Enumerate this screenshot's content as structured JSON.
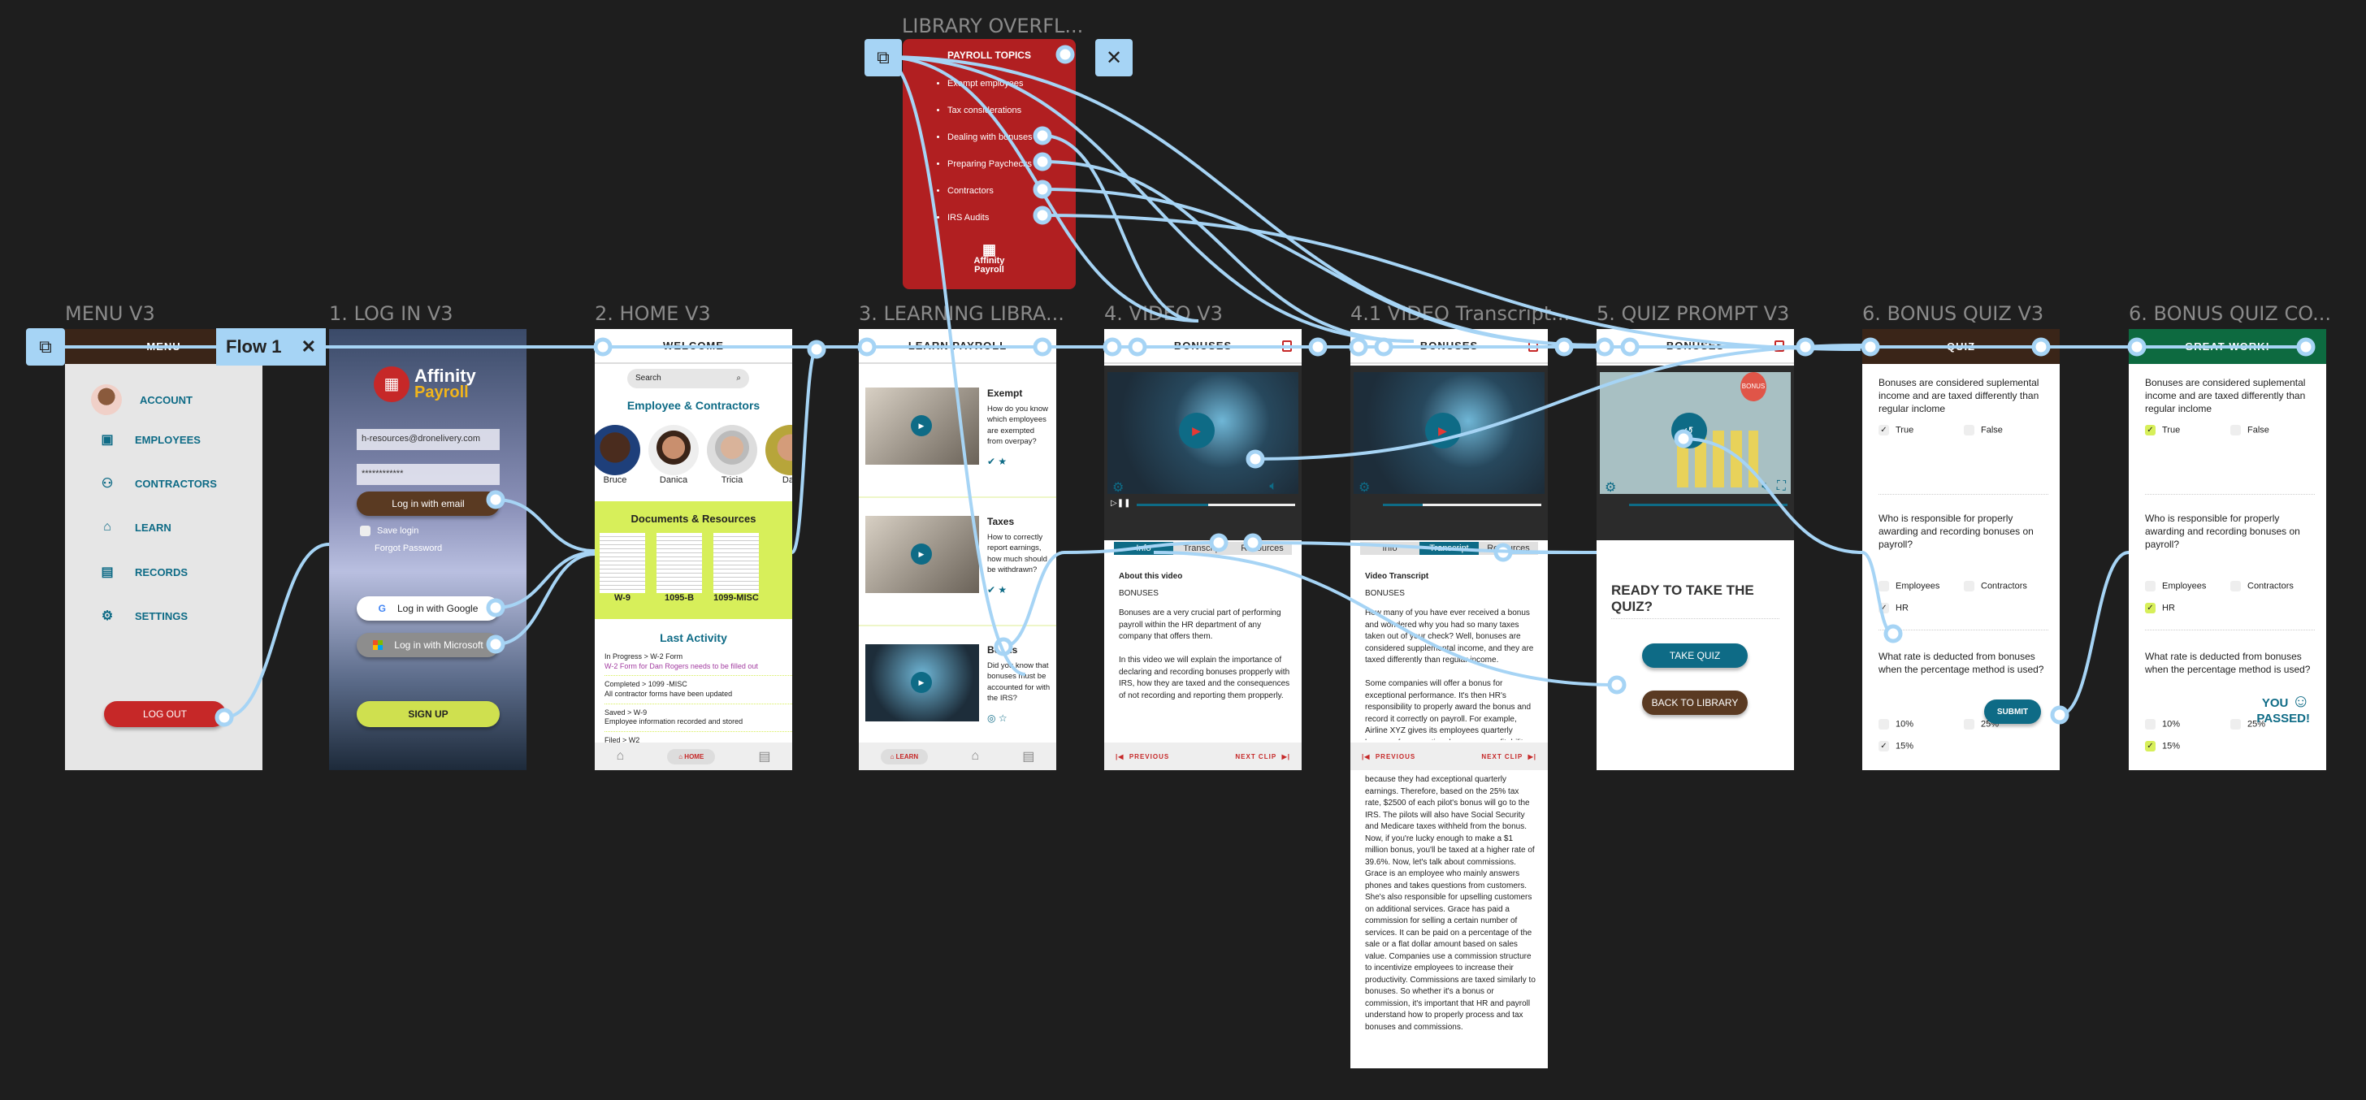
{
  "flow": {
    "label": "Flow 1",
    "close": "✕",
    "device_icon": "device-icon"
  },
  "frames": {
    "menu": {
      "title": "MENU V3",
      "header": "MENU",
      "items": [
        {
          "label": "ACCOUNT",
          "icon": "avatar"
        },
        {
          "label": "EMPLOYEES",
          "icon": "id-badge-icon"
        },
        {
          "label": "CONTRACTORS",
          "icon": "group-icon"
        },
        {
          "label": "LEARN",
          "icon": "graduation-cap-icon"
        },
        {
          "label": "RECORDS",
          "icon": "document-icon"
        },
        {
          "label": "SETTINGS",
          "icon": "gear-icon"
        }
      ],
      "logout": "LOG OUT"
    },
    "login": {
      "title": "1. LOG IN V3",
      "logo_top": "Affinity",
      "logo_bottom": "Payroll",
      "email": "h-resources@dronelivery.com",
      "password": "************",
      "login_email": "Log in with email",
      "save_login": "Save login",
      "forgot": "Forgot Password",
      "google": "Log in with Google",
      "microsoft": "Log in with Microsoft",
      "signup": "SIGN UP"
    },
    "home": {
      "title": "2. HOME V3",
      "header": "WELCOME",
      "search_placeholder": "Search",
      "people_heading": "Employee & Contractors",
      "people": [
        "Bruce",
        "Danica",
        "Tricia",
        "Dan"
      ],
      "docs_heading": "Documents & Resources",
      "docs": [
        "W-9",
        "1095-B",
        "1099-MISC"
      ],
      "activity_heading": "Last Activity",
      "activity": [
        {
          "title": "In Progress > W-2 Form",
          "detail": "W-2 Form for Dan Rogers needs to be filled out"
        },
        {
          "title": "Completed > 1099 -MISC",
          "detail": "All contractor forms have been updated"
        },
        {
          "title": "Saved > W-9",
          "detail": "Employee information recorded and stored"
        },
        {
          "title": "Filed > W2",
          "detail": ""
        }
      ],
      "nav_home": "HOME"
    },
    "learn": {
      "title": "3. LEARNING LIBRA...",
      "header": "LEARN PAYROLL",
      "cards": [
        {
          "title": "Exempt",
          "text": "How do you know which employees are exempted from overpay?",
          "done": true
        },
        {
          "title": "Taxes",
          "text": "How to correctly report earnings, how much should be withdrawn?",
          "done": true
        },
        {
          "title": "Bonus",
          "text": "Did you know that bonuses must be accounted for with the IRS?",
          "done": false
        }
      ],
      "nav_learn": "LEARN"
    },
    "video": {
      "title": "4. VIDEO V3",
      "header": "BONUSES",
      "tabs": [
        "Info",
        "Transcript",
        "Resources"
      ],
      "about": "About this video",
      "subject": "BONUSES",
      "p1": "Bonuses are a very crucial part of performing payroll within the HR department of any company that offers them.",
      "p2": "In this video we will explain the importance of declaring and recording bonuses propperly with IRS, how they are taxed and the consequences of not recording and reporting them propperly.",
      "previous": "PREVIOUS",
      "next": "NEXT CLIP",
      "progress": 0.45
    },
    "transcript": {
      "title": "4.1 VIDEO Transcript...",
      "header": "BONUSES",
      "tabs": [
        "Info",
        "Transcript",
        "Resources"
      ],
      "heading": "Video Transcript",
      "subject": "BONUSES",
      "p1": "How many of you have ever received a bonus and wondered why you had so many taxes taken out of your check? Well, bonuses are considered supplemental income, and they are taxed differently than regular income.",
      "p2": "Some companies will offer a bonus for exceptional performance. It's then HR's responsibility to properly award the bonus and record it correctly on payroll. For example, Airline XYZ gives its employees quarterly bonuses for exceptional company profitability. They use the percentage method, which",
      "p3": "because they had exceptional quarterly earnings. Therefore, based on the 25% tax rate, $2500 of each pilot's bonus will go to the IRS. The pilots will also have Social Security and Medicare taxes withheld from the bonus. Now, if you're lucky enough to make a $1 million bonus, you'll be taxed at a higher rate of 39.6%. Now, let's talk about commissions. Grace is an employee who mainly answers phones and takes questions from customers. She's also responsible for upselling customers on additional services. Grace has paid a commission for selling a certain number of services. It can be paid on a percentage of the sale or a flat dollar amount based on sales value. Companies use a commission structure to incentivize employees to increase their productivity. Commissions are taxed similarly to bonuses. So whether it's a bonus or commission, it's important that HR and payroll understand how to properly process and tax bonuses and commissions.",
      "previous": "PREVIOUS",
      "next": "NEXT CLIP"
    },
    "quizprompt": {
      "title": "5. QUIZ PROMPT V3",
      "header": "BONUSES",
      "balloon": "BONUS",
      "heading": "READY TO TAKE THE QUIZ?",
      "take": "TAKE QUIZ",
      "back": "BACK TO LIBRARY",
      "progress": 1.0
    },
    "quiz": {
      "title": "6. BONUS QUIZ V3",
      "header": "QUIZ",
      "submit": "SUBMIT"
    },
    "complete": {
      "title": "6. BONUS QUIZ CO...",
      "header": "GREAT WORK!",
      "passed_1": "YOU",
      "passed_2": "PASSED!"
    },
    "questions": [
      {
        "q": "Bonuses are considered suplemental income and are taxed differently than regular inclome",
        "options": [
          "True",
          "False"
        ],
        "checked": [
          "True"
        ]
      },
      {
        "q": "Who is responsible for properly awarding and recording bonuses on payroll?",
        "options": [
          "Employees",
          "Contractors",
          "HR"
        ],
        "checked": [
          "HR"
        ]
      },
      {
        "q": "What rate is deducted from bonuses when the percentage method is used?",
        "options": [
          "10%",
          "25%",
          "15%"
        ],
        "checked": [
          "15%"
        ]
      }
    ],
    "library": {
      "title": "LIBRARY OVERFL...",
      "heading": "PAYROLL TOPICS",
      "topics": [
        "Exempt employees",
        "Tax considerations",
        "Dealing with bonuses",
        "Preparing Paychecks",
        "Contractors",
        "IRS Audits"
      ],
      "logo_top": "Affinity",
      "logo_bottom": "Payroll"
    }
  },
  "colors": {
    "teal": "#0e6b86",
    "brown": "#5a3a22",
    "red": "#c62828",
    "lime": "#d7ef5a",
    "green": "#0d6a40",
    "noodle": "#a6d4f5",
    "canvas": "#1e1e1e"
  }
}
